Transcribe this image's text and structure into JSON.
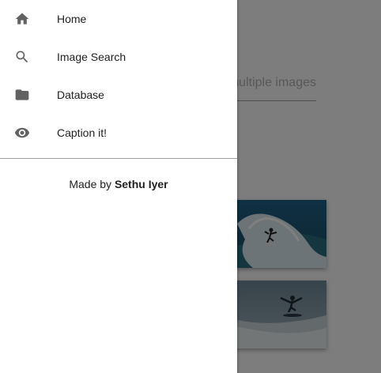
{
  "drawer": {
    "items": [
      {
        "label": "Home",
        "icon": "home-icon"
      },
      {
        "label": "Image Search",
        "icon": "search-icon"
      },
      {
        "label": "Database",
        "icon": "folder-icon"
      },
      {
        "label": "Caption it!",
        "icon": "eye-icon"
      }
    ],
    "credit_prefix": "Made by",
    "credit_author": "Sethu Iyer"
  },
  "background": {
    "input_placeholder": "multiple images"
  },
  "colors": {
    "icon": "#616161",
    "text": "#212121",
    "scrim": "rgba(0,0,0,0.5)"
  }
}
